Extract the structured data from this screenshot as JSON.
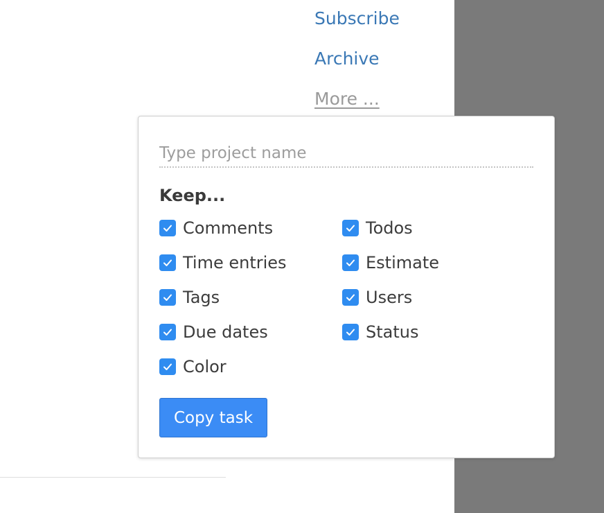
{
  "links": {
    "subscribe": "Subscribe",
    "archive": "Archive",
    "more": "More ..."
  },
  "popover": {
    "input_placeholder": "Type project name",
    "input_value": "",
    "keep_heading": "Keep...",
    "options": [
      {
        "label": "Comments",
        "checked": true
      },
      {
        "label": "Time entries",
        "checked": true
      },
      {
        "label": "Tags",
        "checked": true
      },
      {
        "label": "Due dates",
        "checked": true
      },
      {
        "label": "Color",
        "checked": true
      },
      {
        "label": "Todos",
        "checked": true
      },
      {
        "label": "Estimate",
        "checked": true
      },
      {
        "label": "Users",
        "checked": true
      },
      {
        "label": "Status",
        "checked": true
      }
    ],
    "copy_button": "Copy task"
  },
  "colors": {
    "link": "#3a78b5",
    "accent": "#3b8cf5",
    "checkbox": "#2f8cf0",
    "side_panel": "#7a7a7a"
  },
  "icons": {
    "checkbox": "checkmark-icon"
  }
}
